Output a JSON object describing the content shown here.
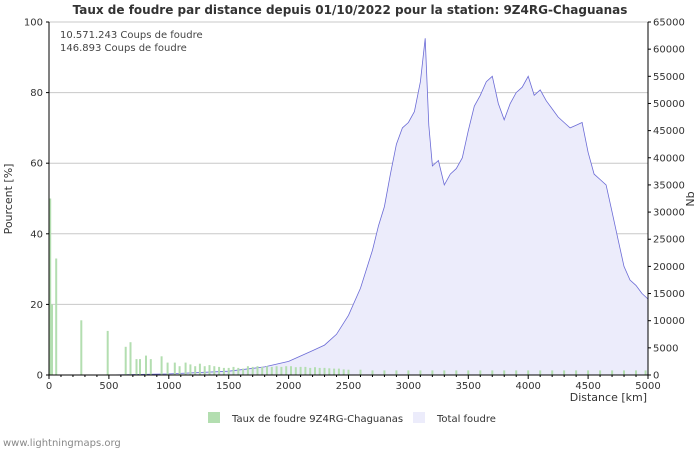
{
  "footer": "www.lightningmaps.org",
  "chart_data": {
    "type": "bar",
    "title": "Taux de foudre par distance depuis 01/10/2022 pour la station: 9Z4RG-Chaguanas",
    "xlabel": "Distance   [km]",
    "ylabel_left": "Pourcent   [%]",
    "ylabel_right": "Nb",
    "xlim": [
      0,
      5000
    ],
    "ylim_left": [
      0,
      100
    ],
    "ylim_right": [
      0,
      65000
    ],
    "x_ticks": [
      0,
      500,
      1000,
      1500,
      2000,
      2500,
      3000,
      3500,
      4000,
      4500,
      5000
    ],
    "y_ticks_left": [
      0,
      20,
      40,
      60,
      80,
      100
    ],
    "y_ticks_right": [
      0,
      5000,
      10000,
      15000,
      20000,
      25000,
      30000,
      35000,
      40000,
      45000,
      50000,
      55000,
      60000,
      65000
    ],
    "grid": true,
    "legend_position": "bottom",
    "annotations": [
      "10.571.243  Coups de foudre",
      "146.893  Coups de foudre"
    ],
    "colors": {
      "rate": "#b3deb0",
      "total_fill": "#ececfb",
      "total_line": "#6b6bd6",
      "grid": "#c8c8c8",
      "axis": "#000000"
    },
    "series": [
      {
        "name": "Taux de foudre 9Z4RG-Chaguanas",
        "axis": "left",
        "style": "bars",
        "x": [
          10,
          25,
          60,
          270,
          490,
          640,
          680,
          730,
          760,
          810,
          850,
          940,
          990,
          1050,
          1090,
          1140,
          1180,
          1220,
          1260,
          1300,
          1340,
          1380,
          1420,
          1460,
          1500,
          1540,
          1580,
          1620,
          1660,
          1700,
          1740,
          1780,
          1820,
          1860,
          1900,
          1940,
          1980,
          2020,
          2060,
          2100,
          2140,
          2180,
          2220,
          2260,
          2300,
          2340,
          2380,
          2420,
          2460,
          2500,
          2600,
          2700,
          2800,
          2900,
          3000,
          3100,
          3200,
          3300,
          3400,
          3500,
          3600,
          3700,
          3800,
          3900,
          4000,
          4100,
          4200,
          4300,
          4400,
          4500,
          4600,
          4700,
          4800,
          4900,
          4980
        ],
        "values": [
          50,
          20,
          33,
          15.5,
          12.5,
          8,
          9.3,
          4.5,
          4.5,
          5.5,
          4.5,
          5.3,
          3.5,
          3.5,
          2.5,
          3.5,
          3,
          2.5,
          3.2,
          2.5,
          2.8,
          2.5,
          2.3,
          2,
          2,
          2.3,
          2,
          1.8,
          2.5,
          2.3,
          2.5,
          2.3,
          2.5,
          2.3,
          2.5,
          2.3,
          2.5,
          2.5,
          2.2,
          2.3,
          2.3,
          2,
          2.2,
          2,
          2,
          1.9,
          1.8,
          1.8,
          1.6,
          1.5,
          1.5,
          1.3,
          1.3,
          1.3,
          1.3,
          1.3,
          1.3,
          1.3,
          1.3,
          1.3,
          1.3,
          1.3,
          1.3,
          1.3,
          1.3,
          1.3,
          1.3,
          1.3,
          1.3,
          1.3,
          1.3,
          1.3,
          1.3,
          1.3,
          1.3
        ]
      },
      {
        "name": "Total foudre",
        "axis": "right",
        "style": "area",
        "x": [
          0,
          500,
          1000,
          1500,
          1800,
          2000,
          2100,
          2200,
          2300,
          2400,
          2500,
          2600,
          2700,
          2750,
          2800,
          2850,
          2900,
          2950,
          3000,
          3050,
          3100,
          3140,
          3170,
          3200,
          3250,
          3300,
          3350,
          3400,
          3450,
          3500,
          3550,
          3600,
          3650,
          3700,
          3750,
          3800,
          3850,
          3900,
          3950,
          4000,
          4050,
          4100,
          4150,
          4200,
          4250,
          4300,
          4350,
          4400,
          4450,
          4500,
          4550,
          4600,
          4650,
          4700,
          4750,
          4800,
          4850,
          4900,
          4950,
          5000
        ],
        "values": [
          0,
          0,
          200,
          700,
          1500,
          2500,
          3500,
          4500,
          5500,
          7500,
          11000,
          16000,
          23000,
          27500,
          31000,
          37000,
          42500,
          45500,
          46500,
          48500,
          54000,
          62000,
          46000,
          38500,
          39500,
          35000,
          37000,
          38000,
          40000,
          45000,
          49500,
          51500,
          54000,
          55000,
          50000,
          47000,
          50000,
          52000,
          53000,
          55000,
          51500,
          52500,
          50500,
          49000,
          47500,
          46500,
          45500,
          46000,
          46500,
          41000,
          37000,
          36000,
          35000,
          30000,
          25000,
          20000,
          17500,
          16500,
          15000,
          14000
        ]
      }
    ]
  }
}
